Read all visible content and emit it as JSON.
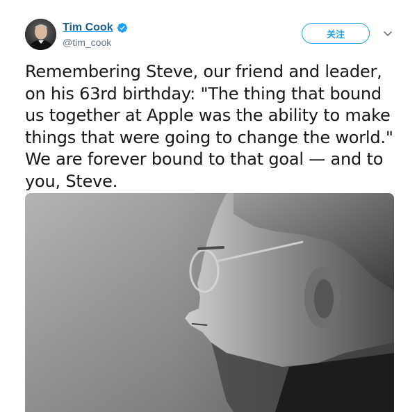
{
  "author": {
    "display_name": "Tim Cook",
    "handle": "@tim_cook",
    "verified_icon": "verified-badge-icon",
    "avatar_icon": "avatar-photo"
  },
  "actions": {
    "follow_label": "关注",
    "more_icon": "chevron-down-icon"
  },
  "tweet": {
    "text": "Remembering Steve, our friend and leader,\non his 63rd birthday: \"The thing that bound\nus together at Apple was the ability to make\nthings that were going to change the world.\"\nWe are forever bound to that goal — and to\nyou, Steve."
  },
  "media": {
    "type": "photo",
    "style": "black-and-white profile portrait"
  },
  "colors": {
    "accent": "#1da1f2",
    "text": "#14171a",
    "muted": "#657786"
  }
}
